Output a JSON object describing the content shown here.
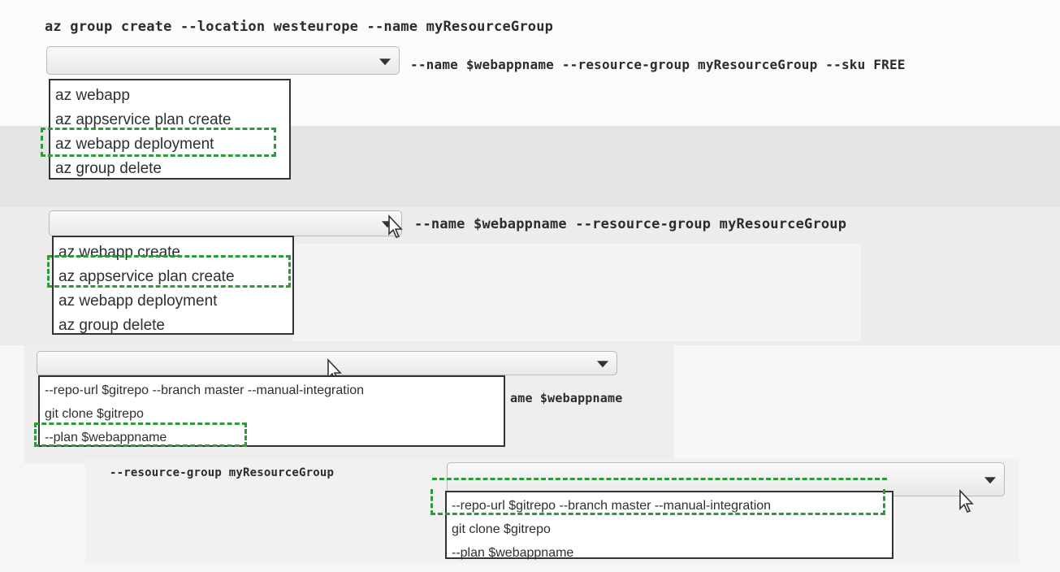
{
  "statements": {
    "line1": "az group create --location westeurope --name myResourceGroup",
    "line2_suffix": "--name $webappname --resource-group myResourceGroup --sku FREE",
    "line3_suffix": "--name $webappname --resource-group myResourceGroup",
    "line4_suffix_fragment": "ame $webappname",
    "line5_prefix": "--resource-group myResourceGroup"
  },
  "dropdown1": {
    "selected": "",
    "options": [
      "az webapp",
      "az appservice plan create",
      "az webapp deployment",
      "az group delete"
    ],
    "highlighted_option": "az webapp deployment"
  },
  "dropdown2": {
    "selected": "",
    "options": [
      "az webapp create",
      "az appservice plan create",
      "az webapp deployment",
      "az group delete"
    ],
    "highlighted_option": "az appservice plan create"
  },
  "dropdown3": {
    "selected": "",
    "options": [
      "--repo-url $gitrepo --branch master --manual-integration",
      "git clone $gitrepo",
      "--plan $webappname"
    ],
    "highlighted_option": "--plan $webappname"
  },
  "dropdown4": {
    "selected": "",
    "options": [
      "--repo-url $gitrepo --branch master --manual-integration",
      "git clone $gitrepo",
      "--plan $webappname"
    ],
    "highlighted_option": "--repo-url $gitrepo --branch master --manual-integration"
  },
  "icons": [
    "dropdown-arrow-icon",
    "mouse-pointer-icon"
  ],
  "colors": {
    "answer_highlight": "#2e9b3a",
    "background": "#f6f6f6",
    "list_border": "#333333"
  }
}
